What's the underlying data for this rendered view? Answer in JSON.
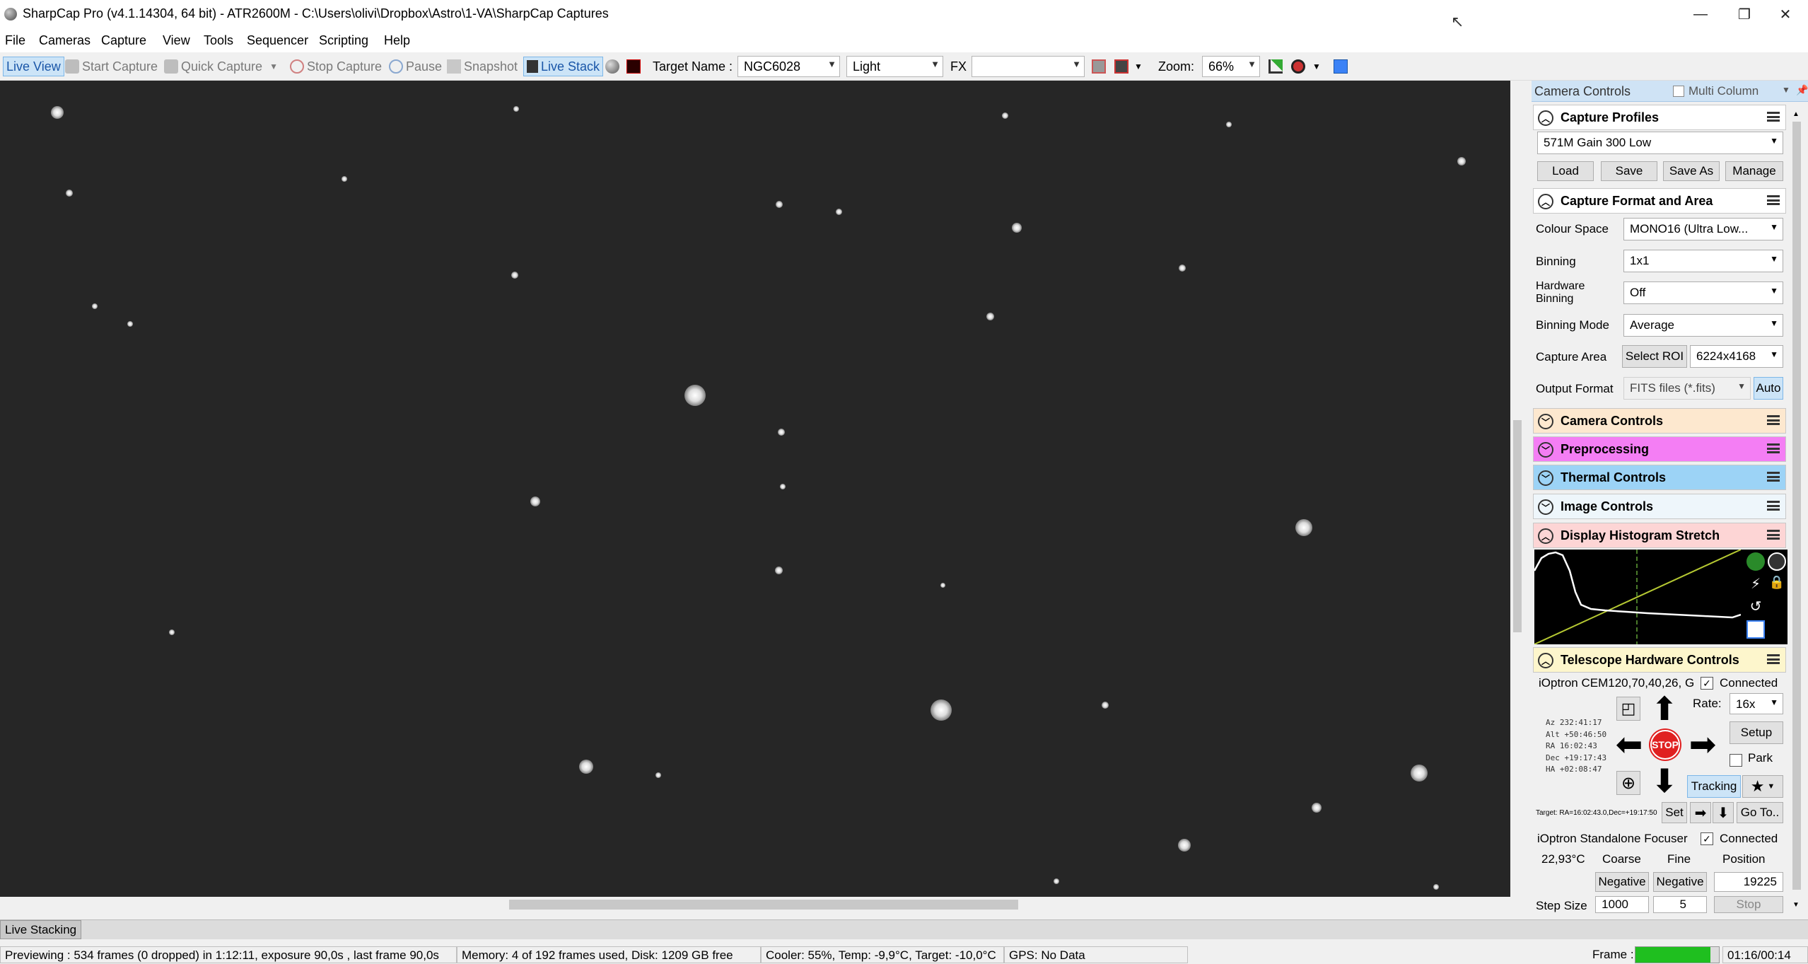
{
  "window": {
    "title": "SharpCap Pro (v4.1.14304, 64 bit) - ATR2600M - C:\\Users\\olivi\\Dropbox\\Astro\\1-VA\\SharpCap Captures",
    "minimize": "—",
    "maximize": "❐",
    "close": "✕"
  },
  "menu": [
    "File",
    "Cameras",
    "Capture",
    "View",
    "Tools",
    "Sequencer",
    "Scripting",
    "Help"
  ],
  "toolbar": {
    "live_view": "Live View",
    "start_capture": "Start Capture",
    "quick_capture": "Quick Capture",
    "stop_capture": "Stop Capture",
    "pause": "Pause",
    "snapshot": "Snapshot",
    "live_stack": "Live Stack",
    "target_label": "Target Name :",
    "target_value": "NGC6028",
    "frame_type": "Light",
    "fx_label": "FX",
    "fx_value": "",
    "zoom_label": "Zoom:",
    "zoom_value": "66%"
  },
  "panel": {
    "header": "Camera Controls",
    "multi_column": "Multi Column",
    "capture_profiles": {
      "title": "Capture Profiles",
      "selected": "571M Gain 300 Low",
      "load": "Load",
      "save": "Save",
      "save_as": "Save As",
      "manage": "Manage"
    },
    "capture_format": {
      "title": "Capture Format and Area",
      "colour_space_label": "Colour Space",
      "colour_space_value": "MONO16 (Ultra Low...",
      "binning_label": "Binning",
      "binning_value": "1x1",
      "hw_binning_label_1": "Hardware",
      "hw_binning_label_2": "Binning",
      "hw_binning_value": "Off",
      "binning_mode_label": "Binning Mode",
      "binning_mode_value": "Average",
      "capture_area_label": "Capture Area",
      "select_roi": "Select ROI",
      "capture_area_value": "6224x4168",
      "output_format_label": "Output Format",
      "output_format_value": "FITS files (*.fits)",
      "auto": "Auto"
    },
    "sections": {
      "camera_controls": "Camera Controls",
      "preprocessing": "Preprocessing",
      "thermal_controls": "Thermal Controls",
      "image_controls": "Image Controls",
      "display_histogram": "Display Histogram Stretch",
      "telescope": "Telescope Hardware Controls"
    },
    "telescope": {
      "mount": "iOptron CEM120,70,40,26, G",
      "connected": "Connected",
      "rate_label": "Rate:",
      "rate_value": "16x",
      "setup": "Setup",
      "park": "Park",
      "tracking": "Tracking",
      "stop": "STOP",
      "coords": [
        "Az   232:41:17",
        "Alt  +50:46:50",
        "RA   16:02:43",
        "Dec  +19:17:43",
        "HA   +02:08:47"
      ],
      "target": "Target: RA=16:02:43.0,Dec=+19:17:50",
      "set": "Set",
      "goto": "Go To.."
    },
    "focuser": {
      "name": "iOptron Standalone Focuser",
      "connected": "Connected",
      "temp": "22,93°C",
      "coarse": "Coarse",
      "fine": "Fine",
      "position": "Position",
      "neg1": "Negative",
      "neg2": "Negative",
      "position_value": "19225",
      "step_size_label": "Step Size",
      "step_size_value": "1000",
      "fine_value": "5",
      "stop": "Stop"
    }
  },
  "live_stacking_tab": "Live Stacking",
  "status": {
    "preview": "Previewing : 534 frames (0 dropped) in 1:12:11, exposure 90,0s , last frame 90,0s",
    "memory": "Memory: 4 of 192 frames used, Disk: 1209 GB free",
    "cooler": "Cooler: 55%, Temp: -9,9°C, Target: -10,0°C",
    "gps": "GPS: No Data",
    "frame_label": "Frame :",
    "frame_progress": 0.9,
    "timer": "01:16/00:14"
  },
  "colors": {
    "accent": "#1a56a8",
    "camera_controls_bg": "#fde8cf",
    "preprocessing_bg": "#f47ef4",
    "thermal_bg": "#9cd3f6",
    "image_controls_bg": "#eef6fb",
    "histogram_bg": "#fdd5d5",
    "telescope_bg": "#fdf6cc",
    "stop_red": "#e02020",
    "frame_green": "#1fbf1f"
  }
}
